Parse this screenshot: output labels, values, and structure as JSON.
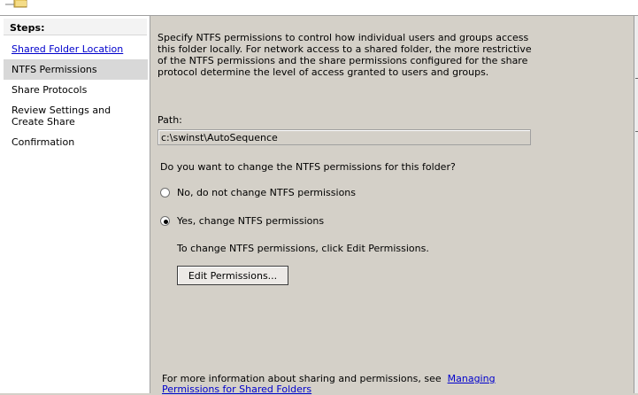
{
  "steps": {
    "title": "Steps:",
    "items": [
      {
        "label": "Shared Folder Location",
        "state": "link"
      },
      {
        "label": "NTFS Permissions",
        "state": "current"
      },
      {
        "label": "Share Protocols",
        "state": "pending"
      },
      {
        "label": "Review Settings and Create Share",
        "state": "pending"
      },
      {
        "label": "Confirmation",
        "state": "pending"
      }
    ]
  },
  "main": {
    "intro": "Specify NTFS permissions to control how individual users and groups access this folder locally. For network access to a shared folder, the more restrictive of the NTFS permissions and the share permissions configured for the share protocol determine the level of access granted to users and groups.",
    "path_label": "Path:",
    "path_value": "c:\\swinst\\AutoSequence",
    "question": "Do you want to change the NTFS permissions for this folder?",
    "options": [
      {
        "label": "No, do not change NTFS permissions",
        "selected": false
      },
      {
        "label": "Yes, change NTFS permissions",
        "selected": true
      }
    ],
    "edit_hint": "To change NTFS permissions, click Edit Permissions.",
    "edit_button": "Edit Permissions...",
    "footer_text": "For more information about sharing and permissions, see",
    "footer_link": "Managing Permissions for Shared Folders"
  },
  "icons": {
    "wizard": "folder-share-icon",
    "radio": "radio-button-icon"
  },
  "colors": {
    "link": "#0000cc",
    "dialog_background": "#d4d0c8",
    "current_step_highlight": "#d8d8d8"
  }
}
